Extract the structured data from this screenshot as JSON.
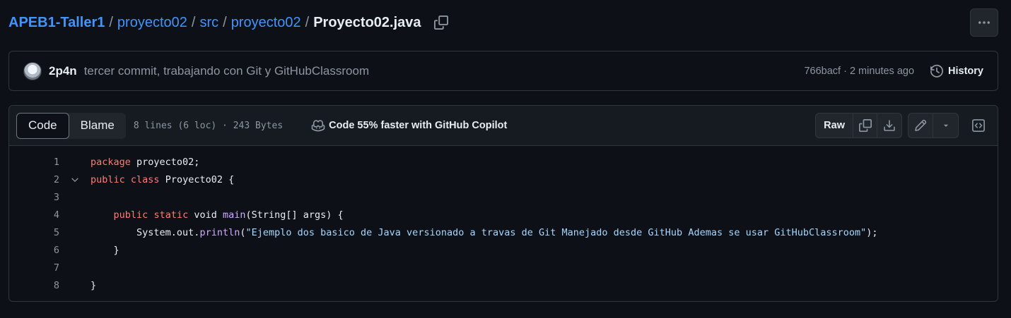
{
  "breadcrumb": {
    "repo": "APEB1-Taller1",
    "folders": [
      "proyecto02",
      "src",
      "proyecto02"
    ],
    "separator": "/",
    "file": "Proyecto02.java"
  },
  "commit": {
    "author": "2p4n",
    "message": "tercer commit, trabajando con Git y GitHubClassroom",
    "meta": "766bacf · 2 minutes ago",
    "history_label": "History"
  },
  "file_header": {
    "tab_code": "Code",
    "tab_blame": "Blame",
    "info": "8 lines (6 loc) · 243 Bytes",
    "copilot_label": "Code 55% faster with GitHub Copilot",
    "raw_label": "Raw"
  },
  "code": {
    "line_numbers": [
      "1",
      "2",
      "3",
      "4",
      "5",
      "6",
      "7",
      "8"
    ],
    "l1_kw": "package",
    "l1_rest": " proyecto02;",
    "l2_kw1": "public",
    "l2_kw2": "class",
    "l2_rest": " Proyecto02 {",
    "l4_indent": "    ",
    "l4_kw1": "public",
    "l4_kw2": "static",
    "l4_mid": " void ",
    "l4_fn": "main",
    "l4_rest": "(String[] args) {",
    "l5_pre": "        System.out.",
    "l5_fn": "println",
    "l5_open": "(",
    "l5_str": "\"Ejemplo dos basico de Java versionado a travas de Git Manejado desde GitHub Ademas se usar GitHubClassroom\"",
    "l5_close": ");",
    "l6": "    }",
    "l8": "}"
  },
  "icons": {
    "copy": "copy-icon",
    "more": "kebab-horizontal-icon",
    "history": "history-icon",
    "copilot": "copilot-icon",
    "download": "download-icon",
    "edit": "pencil-icon",
    "dropdown": "triangle-down-icon",
    "symbols": "code-square-icon",
    "fold": "chevron-down-icon"
  }
}
